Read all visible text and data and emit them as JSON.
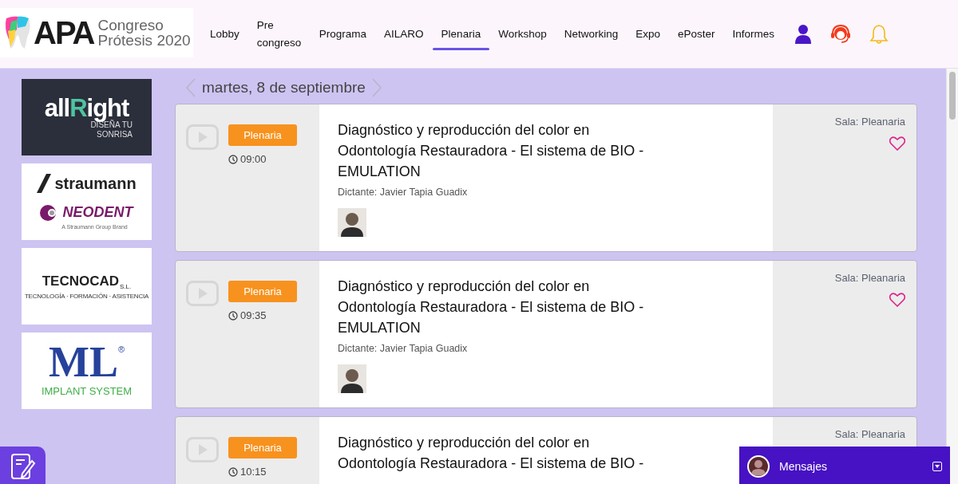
{
  "header": {
    "logo": {
      "brand": "APA",
      "line1": "Congreso",
      "line2": "Prótesis 2020"
    },
    "nav": [
      {
        "label": "Lobby",
        "selected": false
      },
      {
        "label": "Pre congreso",
        "selected": false
      },
      {
        "label": "Programa",
        "selected": false
      },
      {
        "label": "AILARO",
        "selected": false
      },
      {
        "label": "Plenaria",
        "selected": true
      },
      {
        "label": "Workshop",
        "selected": false
      },
      {
        "label": "Networking",
        "selected": false
      },
      {
        "label": "Expo",
        "selected": false
      },
      {
        "label": "ePoster",
        "selected": false
      },
      {
        "label": "Informes",
        "selected": false
      }
    ]
  },
  "sponsors": [
    {
      "kind": "allright",
      "brand_parts": [
        "all",
        "R",
        "ight"
      ],
      "tagline_1": "DISEÑA TU",
      "tagline_2": "SONRISA"
    },
    {
      "kind": "straumann",
      "brand": "straumann",
      "brand_2": "NEODENT",
      "sub": "A Straumann Group Brand"
    },
    {
      "kind": "tecnocad",
      "brand": "TECNOCAD",
      "suffix": "S.L.",
      "sub": "TECNOLOGÍA · FORMACIÓN · ASISTENCIA"
    },
    {
      "kind": "ml",
      "brand": "ML",
      "mark": "®",
      "sub": "IMPLANT SYSTEM"
    }
  ],
  "date_nav": {
    "date": "martes, 8 de septiembre"
  },
  "sessions": [
    {
      "tag": "Plenaria",
      "time": "09:00",
      "title": "Diagnóstico y reproducción del color en Odontología Restauradora - El sistema de BIO - EMULATION",
      "speaker": "Dictante: Javier Tapia Guadix",
      "room": "Sala: Pleanaria",
      "favorite": false
    },
    {
      "tag": "Plenaria",
      "time": "09:35",
      "title": "Diagnóstico y reproducción del color en Odontología Restauradora - El sistema de BIO - EMULATION",
      "speaker": "Dictante: Javier Tapia Guadix",
      "room": "Sala: Pleanaria",
      "favorite": false
    },
    {
      "tag": "Plenaria",
      "time": "10:15",
      "title": "Diagnóstico y reproducción del color en Odontología Restauradora - El sistema de BIO -",
      "room": "Sala: Pleanaria"
    }
  ],
  "messages": {
    "label": "Mensajes"
  }
}
